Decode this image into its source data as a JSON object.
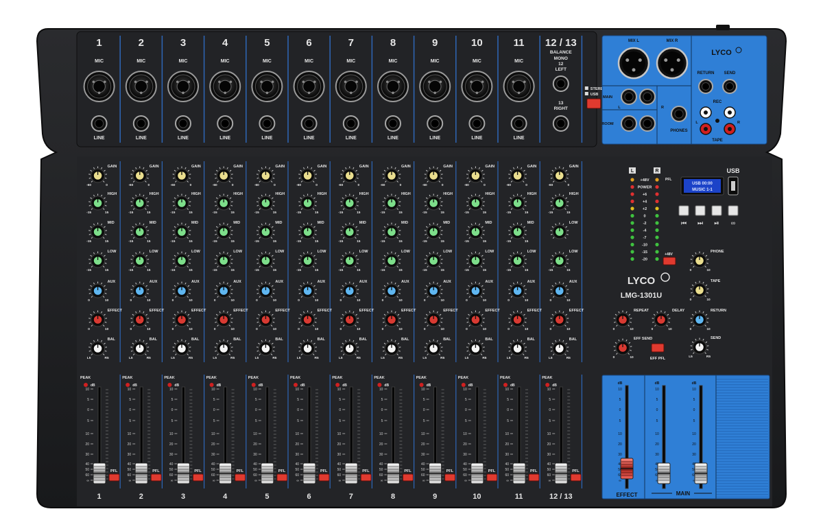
{
  "brand": "LYCO",
  "model": "LMG-1301U",
  "colors": {
    "body": "#1f1f21",
    "panel": "#26272a",
    "accent_blue": "#2f7fd6",
    "line_blue": "#2e67b8",
    "gain_knob": "#e9dd8e",
    "eq_knob": "#7dde8a",
    "aux_knob": "#5fb6f0",
    "effect_knob": "#d83a32",
    "bal_knob": "#f4f4f4",
    "button_red": "#e03a2f"
  },
  "channels": {
    "numbers": [
      "1",
      "2",
      "3",
      "4",
      "5",
      "6",
      "7",
      "8",
      "9",
      "10",
      "11",
      "12 / 13"
    ],
    "mic_label": "MIC",
    "line_label": "LINE",
    "stereo_labels": [
      "BALANCE",
      "MONO",
      "12",
      "LEFT",
      "13",
      "RIGHT"
    ],
    "stereo_usb": [
      "STEREO",
      "USB"
    ]
  },
  "knob_labels": {
    "gain": "GAIN",
    "gain_min": "-60",
    "gain_max": "0",
    "high": "HIGH",
    "mid": "MID",
    "low": "LOW",
    "eq_min": "-15",
    "eq_max": "15",
    "aux": "AUX",
    "effect": "EFFECT",
    "level_min": "0",
    "level_max": "10",
    "bal": "BAL",
    "bal_min": "L5",
    "bal_max": "R5"
  },
  "fader": {
    "peak": "PEAK",
    "db": "dB",
    "scale": [
      "10",
      "5",
      "0",
      "5",
      "10",
      "20",
      "30",
      "40",
      "50",
      "60",
      "∞"
    ],
    "pfl": "PFL"
  },
  "io": {
    "mix_l": "MIX L",
    "mix_r": "MIX R",
    "main": "MAIN",
    "l": "L",
    "r": "R",
    "room": "ROOM",
    "phones": "PHONES",
    "return": "RETURN",
    "send": "SEND",
    "rec": "REC",
    "tape": "TAPE"
  },
  "meter": {
    "l": "L",
    "r": "R",
    "labels": [
      "+48V",
      "POWER",
      "+6",
      "+4",
      "+2",
      "0",
      "-2",
      "-4",
      "-7",
      "-10",
      "-15",
      "-20"
    ],
    "pfl": "PFL",
    "phantom": "+48V"
  },
  "usb": {
    "label": "USB",
    "display": "USB  00:00",
    "display_line2": "MUSIC 1-1"
  },
  "master_knobs": {
    "phone": "PHONE",
    "tape": "TAPE",
    "return": "RETURN",
    "send": "SEND",
    "repeat": "REPEAT",
    "delay": "DELAY",
    "eff_send": "EFF SEND",
    "eff_pfl": "EFF PFL",
    "min": "0",
    "max": "10",
    "l5": "L5",
    "r5": "R5"
  },
  "master_faders": {
    "effect": "EFFECT",
    "main": "MAIN"
  }
}
